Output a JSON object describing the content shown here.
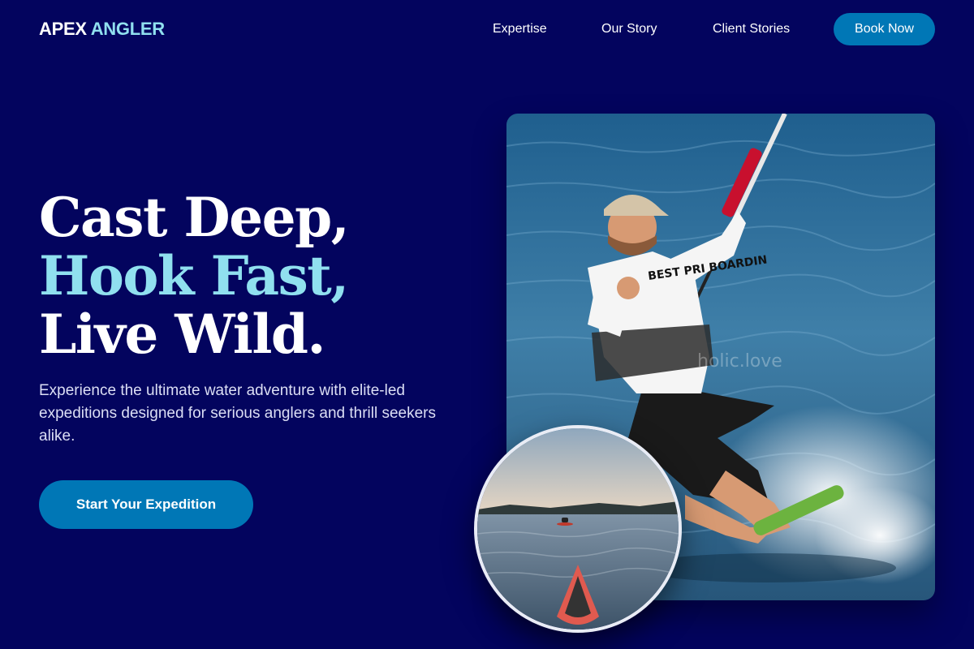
{
  "header": {
    "logo_primary": "APEX",
    "logo_accent": "ANGLER",
    "nav": [
      {
        "label": "Expertise"
      },
      {
        "label": "Our Story"
      },
      {
        "label": "Client Stories"
      }
    ],
    "cta_label": "Book Now"
  },
  "hero": {
    "title_line1": "Cast Deep,",
    "title_line2": "Hook Fast,",
    "title_line3": "Live Wild.",
    "description": "Experience the ultimate water adventure with elite-led expeditions designed for serious anglers and thrill seekers alike.",
    "cta_label": "Start Your Expedition"
  },
  "images": {
    "main_alt": "Kiteboarder riding across the water giving a shaka sign",
    "shirt_text": "BEST PRI BOARDIN",
    "watermark": "holic.love",
    "secondary_alt": "Kayak on a calm lake at dusk"
  },
  "colors": {
    "background": "#03045e",
    "accent_text": "#90e0ef",
    "button": "#0077b6",
    "text": "#ffffff"
  }
}
